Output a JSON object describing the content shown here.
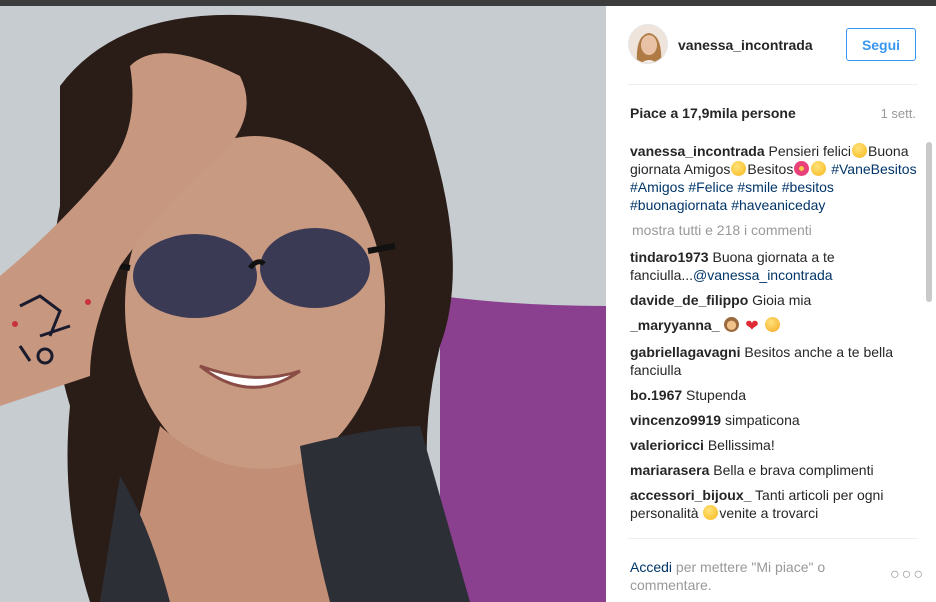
{
  "post": {
    "username": "vanessa_incontrada",
    "follow_label": "Segui",
    "likes": "Piace a 17,9mila persone",
    "time": "1 sett.",
    "options_icon": "ellipsis-icon"
  },
  "caption": {
    "user": "vanessa_incontrada",
    "text1": "Pensieri felici",
    "text2": "Buona giornata Amigos",
    "text3": "Besitos",
    "hashtags": [
      "#VaneBesitos",
      "#Amigos",
      "#Felice",
      "#smile",
      "#besitos",
      "#buonagiornata",
      "#haveaniceday"
    ]
  },
  "more_comments": "mostra tutti e 218 i commenti",
  "comments": [
    {
      "user": "tindaro1973",
      "text": "Buona giornata a te fanciulla...",
      "mention": "@vanessa_incontrada"
    },
    {
      "user": "davide_de_filippo",
      "text": "Gioia mia"
    },
    {
      "user": "_maryyanna_",
      "text": ""
    },
    {
      "user": "gabriellagavagni",
      "text": "Besitos anche a te bella fanciulla"
    },
    {
      "user": "bo.1967",
      "text": "Stupenda"
    },
    {
      "user": "vincenzo9919",
      "text": "simpaticona"
    },
    {
      "user": "valerioricci",
      "text": "Bellissima!"
    },
    {
      "user": "mariarasera",
      "text": "Bella e brava complimenti"
    },
    {
      "user": "accessori_bijoux_",
      "text": "Tanti articoli per ogni personalità",
      "text_after": "venite a trovarci"
    }
  ],
  "footer": {
    "login": "Accedi",
    "rest": "per mettere \"Mi piace\" o commentare."
  },
  "colors": {
    "accent": "#3897f0",
    "link": "#003569",
    "muted": "#999999"
  }
}
